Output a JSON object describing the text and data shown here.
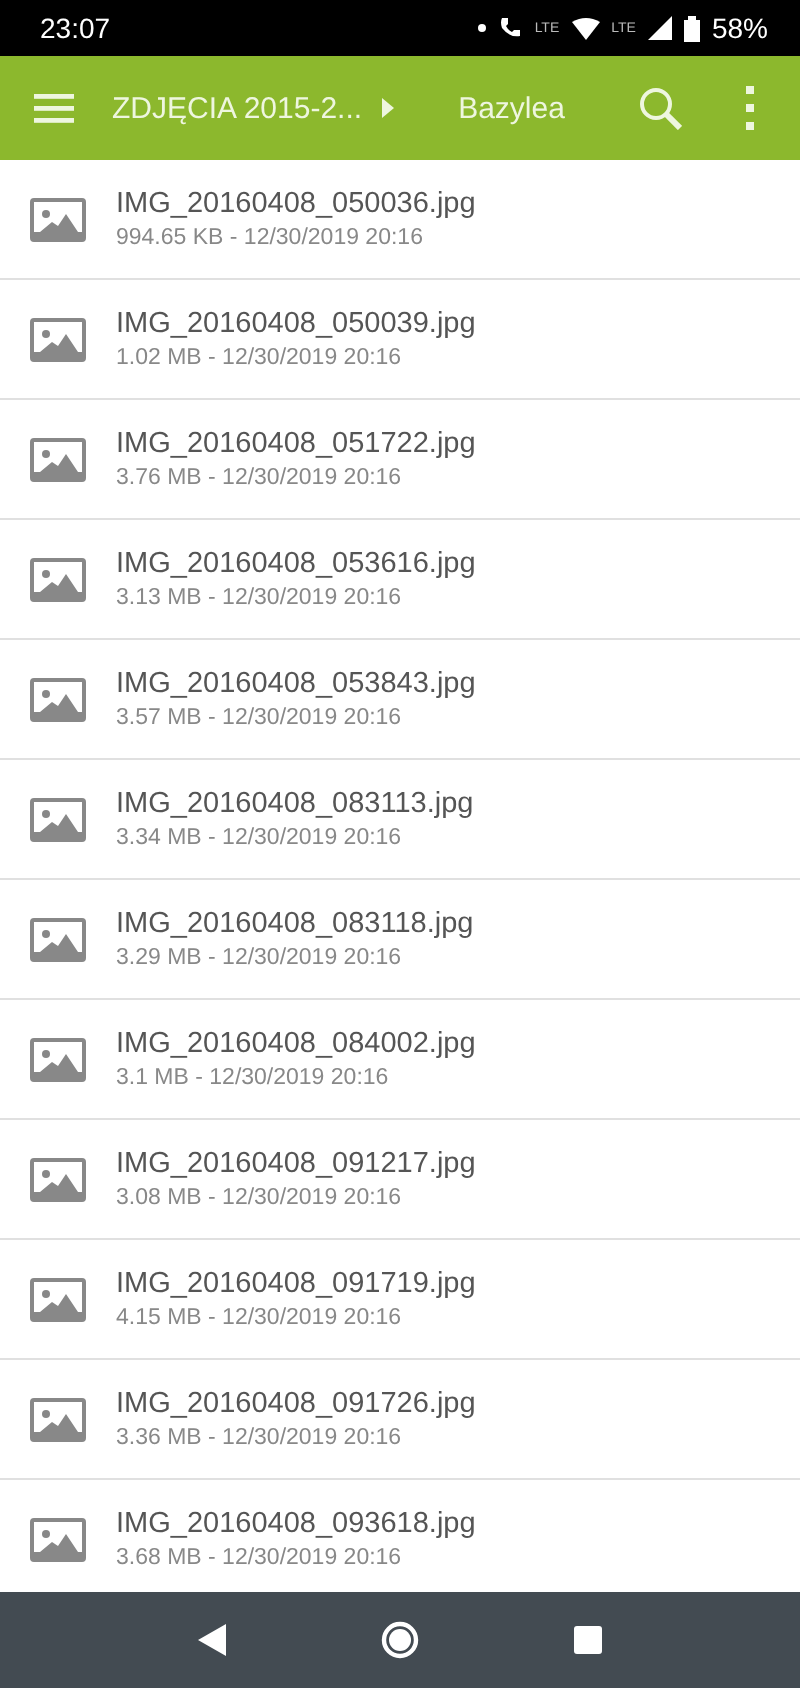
{
  "status_bar": {
    "time": "23:07",
    "call_label": "LTE",
    "network_label": "LTE",
    "battery": "58%"
  },
  "toolbar": {
    "breadcrumb": "ZDJĘCIA 2015-2...",
    "current_folder": "Bazylea"
  },
  "files": [
    {
      "name": "IMG_20160408_050036.jpg",
      "details": "994.65 KB - 12/30/2019 20:16"
    },
    {
      "name": "IMG_20160408_050039.jpg",
      "details": "1.02 MB - 12/30/2019 20:16"
    },
    {
      "name": "IMG_20160408_051722.jpg",
      "details": "3.76 MB - 12/30/2019 20:16"
    },
    {
      "name": "IMG_20160408_053616.jpg",
      "details": "3.13 MB - 12/30/2019 20:16"
    },
    {
      "name": "IMG_20160408_053843.jpg",
      "details": "3.57 MB - 12/30/2019 20:16"
    },
    {
      "name": "IMG_20160408_083113.jpg",
      "details": "3.34 MB - 12/30/2019 20:16"
    },
    {
      "name": "IMG_20160408_083118.jpg",
      "details": "3.29 MB - 12/30/2019 20:16"
    },
    {
      "name": "IMG_20160408_084002.jpg",
      "details": "3.1 MB - 12/30/2019 20:16"
    },
    {
      "name": "IMG_20160408_091217.jpg",
      "details": "3.08 MB - 12/30/2019 20:16"
    },
    {
      "name": "IMG_20160408_091719.jpg",
      "details": "4.15 MB - 12/30/2019 20:16"
    },
    {
      "name": "IMG_20160408_091726.jpg",
      "details": "3.36 MB - 12/30/2019 20:16"
    },
    {
      "name": "IMG_20160408_093618.jpg",
      "details": "3.68 MB - 12/30/2019 20:16"
    }
  ]
}
